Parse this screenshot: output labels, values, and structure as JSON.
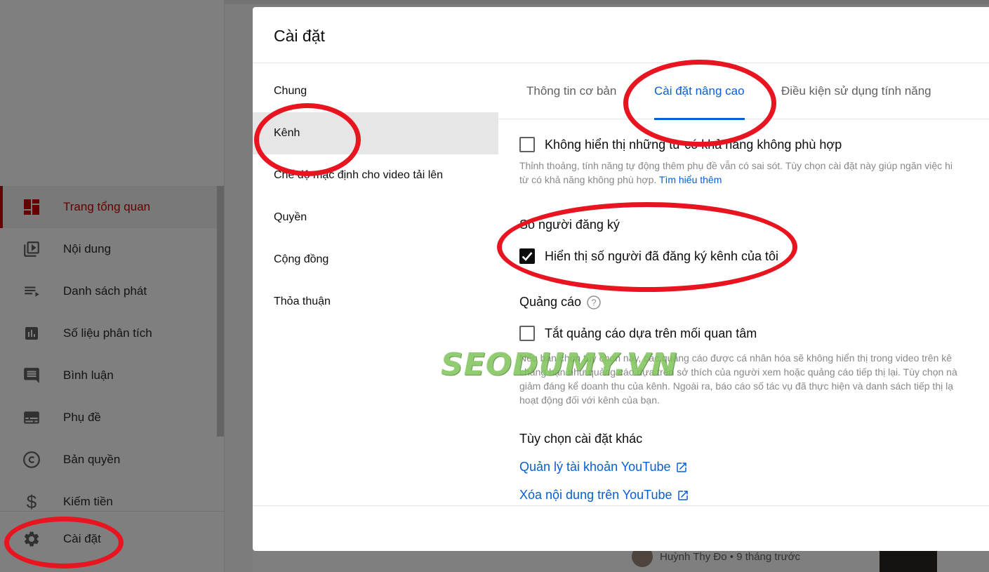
{
  "sidebar": {
    "items": [
      {
        "label": "Trang tổng quan",
        "icon": "dashboard-icon",
        "active": true
      },
      {
        "label": "Nội dung",
        "icon": "video-library-icon",
        "active": false
      },
      {
        "label": "Danh sách phát",
        "icon": "playlist-icon",
        "active": false
      },
      {
        "label": "Số liệu phân tích",
        "icon": "analytics-icon",
        "active": false
      },
      {
        "label": "Bình luận",
        "icon": "comments-icon",
        "active": false
      },
      {
        "label": "Phụ đề",
        "icon": "subtitles-icon",
        "active": false
      },
      {
        "label": "Bản quyền",
        "icon": "copyright-icon",
        "active": false
      },
      {
        "label": "Kiếm tiền",
        "icon": "dollar-icon",
        "active": false
      }
    ],
    "settings_label": "Cài đặt",
    "settings_icon": "gear-icon"
  },
  "background": {
    "comment_text": "Huỳnh Thy Đo • 9 tháng trước"
  },
  "dialog": {
    "title": "Cài đặt",
    "nav": [
      {
        "label": "Chung",
        "selected": false
      },
      {
        "label": "Kênh",
        "selected": true
      },
      {
        "label": "Chế độ mặc định cho video tải lên",
        "selected": false
      },
      {
        "label": "Quyền",
        "selected": false
      },
      {
        "label": "Cộng đồng",
        "selected": false
      },
      {
        "label": "Thỏa thuận",
        "selected": false
      }
    ],
    "tabs": [
      {
        "label": "Thông tin cơ bản",
        "active": false
      },
      {
        "label": "Cài đặt nâng cao",
        "active": true
      },
      {
        "label": "Điều kiện sử dụng tính năng",
        "active": false
      }
    ],
    "captions": {
      "checkbox_label": "Không hiển thị những từ có khả năng không phù hợp",
      "checked": false,
      "help_line1": "Thỉnh thoảng, tính năng tự động thêm phụ đề vẫn có sai sót. Tùy chọn cài đặt này giúp ngăn việc hi",
      "help_line2": "từ có khả năng không phù hợp.",
      "learn_more": "Tìm hiểu thêm"
    },
    "subscribers": {
      "title": "Số người đăng ký",
      "checkbox_label": "Hiển thị số người đã đăng ký kênh của tôi",
      "checked": true
    },
    "ads": {
      "title": "Quảng cáo",
      "checkbox_label": "Tắt quảng cáo dựa trên mối quan tâm",
      "checked": false,
      "help_lines": [
        "Nếu bạn chọn tùy chọn này, các quảng cáo được cá nhân hóa sẽ không hiển thị trong video trên kê",
        "chẳng hạn như quảng cáo dựa trên sở thích của người xem hoặc quảng cáo tiếp thị lại. Tùy chọn nà",
        "giảm đáng kể doanh thu của kênh. Ngoài ra, báo cáo số tác vụ đã thực hiện và danh sách tiếp thị lạ",
        "hoạt động đối với kênh của bạn."
      ]
    },
    "other": {
      "title": "Tùy chọn cài đặt khác",
      "links": [
        {
          "label": "Quản lý tài khoản YouTube",
          "icon": "external-link-icon"
        },
        {
          "label": "Xóa nội dung trên YouTube",
          "icon": "external-link-icon"
        }
      ]
    }
  },
  "watermark": "SEODUMY.VN",
  "colors": {
    "accent_red": "#cc0000",
    "link_blue": "#065fd4",
    "annotation_red": "#e8141f",
    "watermark_green": "#7fc45a"
  }
}
